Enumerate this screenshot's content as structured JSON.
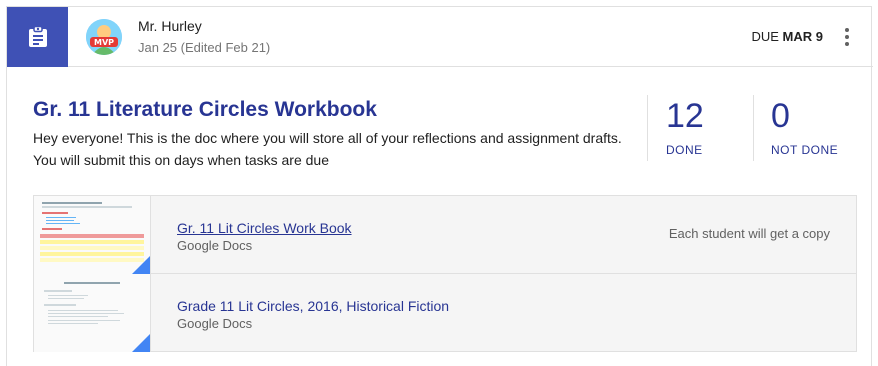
{
  "header": {
    "author": "Mr. Hurley",
    "date": "Jan 25 (Edited Feb 21)",
    "due_label": "DUE",
    "due_date": "MAR 9",
    "avatar_text": "MVP",
    "icon": "assignment-icon",
    "more_icon": "more-vert-icon"
  },
  "assignment": {
    "title": "Gr. 11 Literature Circles Workbook",
    "description_line1": "Hey everyone! This is the doc where you will store all of your reflections and assignment drafts.",
    "description_line2": "You will submit this on days when tasks are due"
  },
  "stats": {
    "done_count": "12",
    "done_label": "DONE",
    "not_done_count": "0",
    "not_done_label": "NOT DONE"
  },
  "attachments": [
    {
      "title": "Gr. 11 Lit Circles Work Book",
      "type": "Google Docs",
      "note": "Each student will get a copy"
    },
    {
      "title": "Grade 11 Lit Circles, 2016, Historical Fiction",
      "type": "Google Docs"
    }
  ],
  "colors": {
    "accent": "#3f51b5",
    "title": "#283593",
    "docs_corner": "#4285f4"
  }
}
